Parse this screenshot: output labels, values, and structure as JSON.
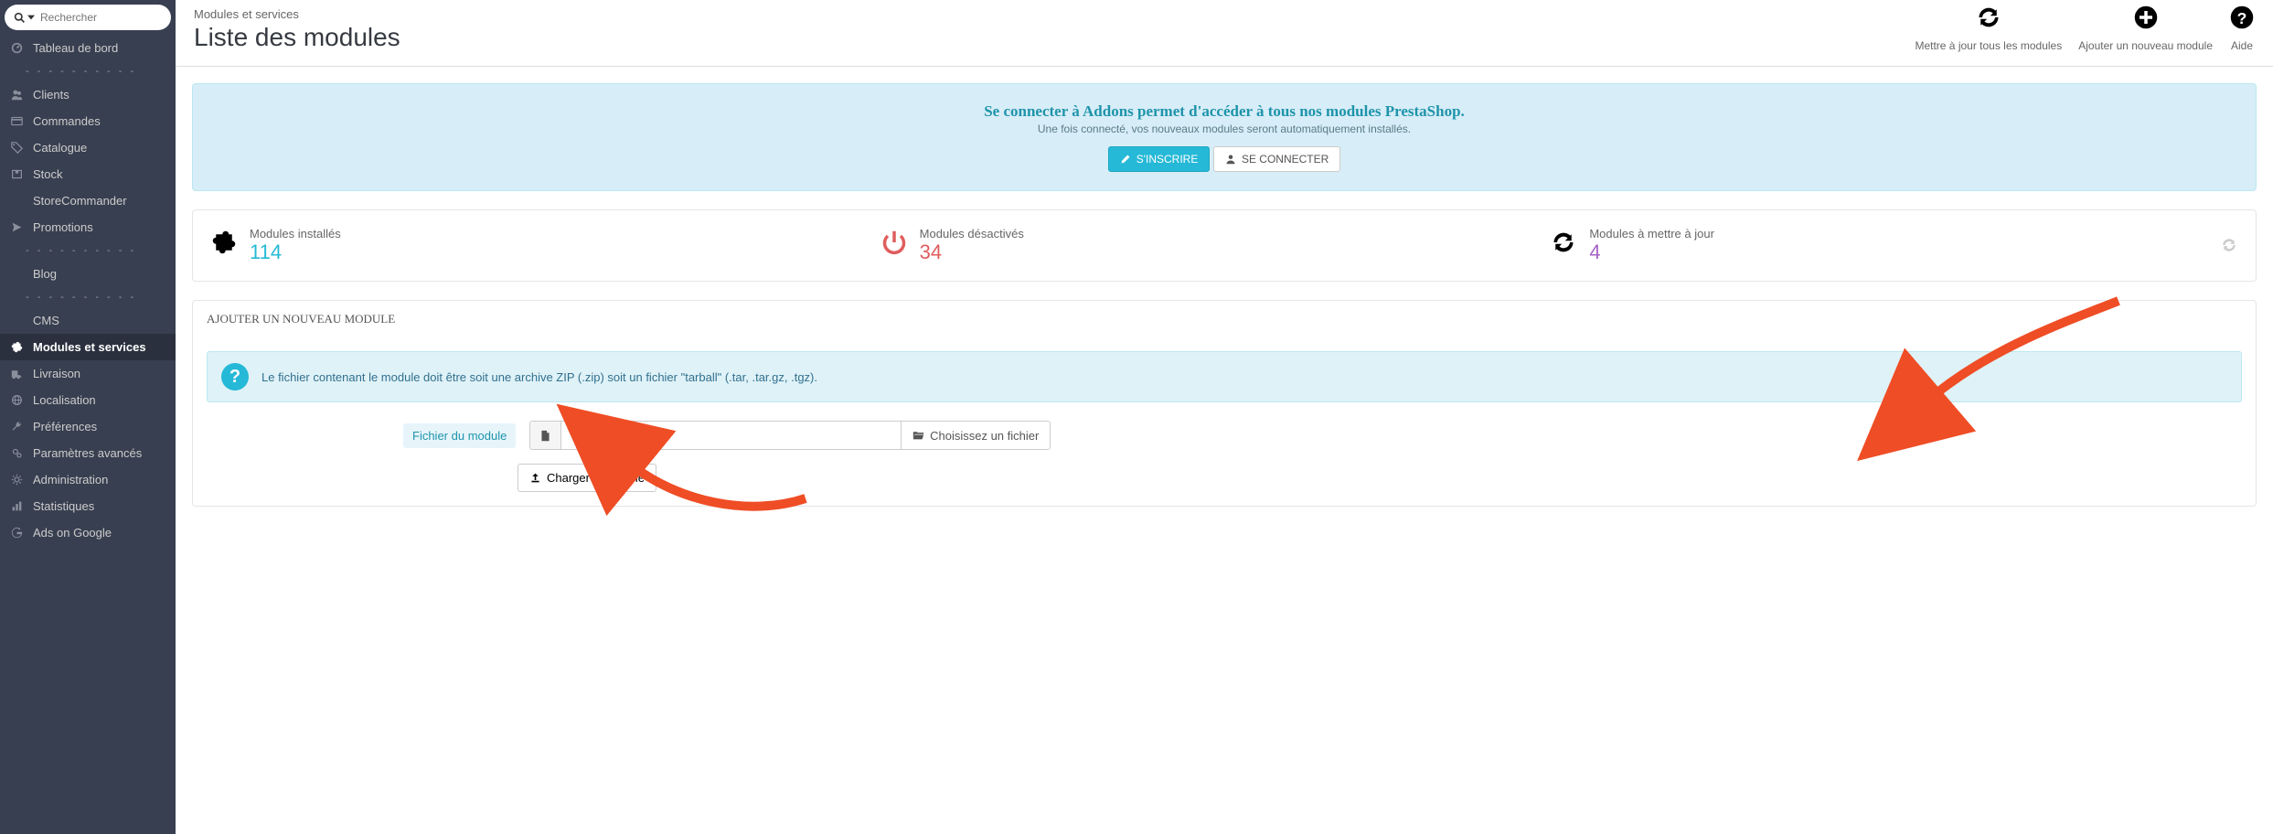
{
  "search": {
    "placeholder": "Rechercher"
  },
  "sidebar": {
    "items": [
      {
        "label": "Tableau de bord",
        "icon": "dashboard"
      },
      {
        "separator": true
      },
      {
        "label": "Clients",
        "icon": "users"
      },
      {
        "label": "Commandes",
        "icon": "orders"
      },
      {
        "label": "Catalogue",
        "icon": "tag"
      },
      {
        "label": "Stock",
        "icon": "stock"
      },
      {
        "label": "StoreCommander",
        "icon": ""
      },
      {
        "label": "Promotions",
        "icon": "promo"
      },
      {
        "separator": true
      },
      {
        "label": "Blog",
        "icon": ""
      },
      {
        "separator": true
      },
      {
        "label": "CMS",
        "icon": ""
      },
      {
        "label": "Modules et services",
        "icon": "puzzle",
        "active": true
      },
      {
        "label": "Livraison",
        "icon": "truck"
      },
      {
        "label": "Localisation",
        "icon": "globe"
      },
      {
        "label": "Préférences",
        "icon": "wrench"
      },
      {
        "label": "Paramètres avancés",
        "icon": "gears"
      },
      {
        "label": "Administration",
        "icon": "cogwheel"
      },
      {
        "label": "Statistiques",
        "icon": "stats"
      },
      {
        "label": "Ads on Google",
        "icon": "google"
      }
    ]
  },
  "header": {
    "breadcrumb": "Modules et services",
    "title": "Liste des modules",
    "actions": {
      "update": "Mettre à jour tous les modules",
      "add": "Ajouter un nouveau module",
      "help": "Aide"
    }
  },
  "addons": {
    "title": "Se connecter à Addons permet d'accéder à tous nos modules PrestaShop.",
    "sub": "Une fois connecté, vos nouveaux modules seront automatiquement installés.",
    "signup": "S'INSCRIRE",
    "login": "SE CONNECTER"
  },
  "stats": {
    "installed": {
      "label": "Modules installés",
      "value": "114"
    },
    "disabled": {
      "label": "Modules désactivés",
      "value": "34"
    },
    "toupdate": {
      "label": "Modules à mettre à jour",
      "value": "4"
    }
  },
  "upload": {
    "panel_title": "AJOUTER UN NOUVEAU MODULE",
    "info": "Le fichier contenant le module doit être soit une archive ZIP (.zip) soit un fichier \"tarball\" (.tar, .tar.gz, .tgz).",
    "file_label": "Fichier du module",
    "choose": "Choisissez un fichier",
    "submit": "Charger le module"
  }
}
